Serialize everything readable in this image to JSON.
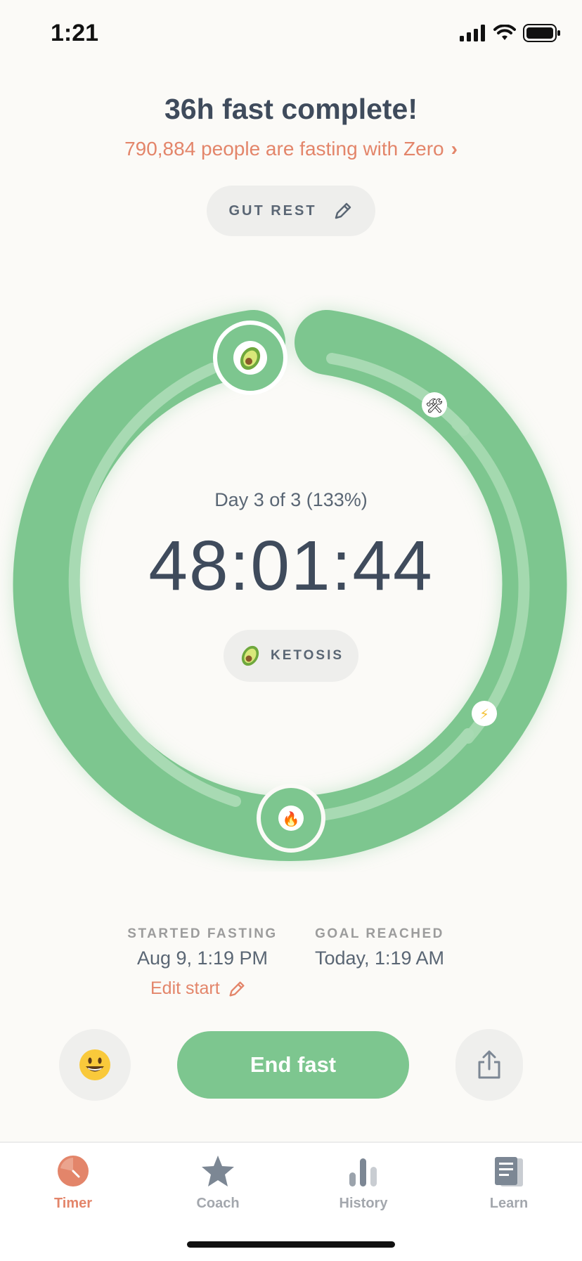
{
  "status_bar": {
    "time": "1:21"
  },
  "header": {
    "title": "36h fast complete!",
    "subtitle": "790,884 people are fasting with Zero",
    "subtitle_chevron": "›",
    "fast_type": "GUT REST"
  },
  "timer": {
    "day_label": "Day 3 of 3 (133%)",
    "elapsed": "48:01:44",
    "stage": "KETOSIS",
    "progress_percent": 133,
    "stage_icons": [
      "avocado-icon",
      "tools-icon",
      "lightning-icon",
      "fire-icon"
    ]
  },
  "details": {
    "started_label": "STARTED FASTING",
    "started_value": "Aug 9, 1:19 PM",
    "goal_label": "GOAL REACHED",
    "goal_value": "Today, 1:19 AM",
    "edit_start": "Edit start"
  },
  "actions": {
    "end_fast": "End fast"
  },
  "tabs": [
    {
      "label": "Timer",
      "active": true
    },
    {
      "label": "Coach",
      "active": false
    },
    {
      "label": "History",
      "active": false
    },
    {
      "label": "Learn",
      "active": false
    }
  ],
  "colors": {
    "accent": "#E3856A",
    "ring_green": "#7DC68F",
    "text_dark": "#3F4B5C",
    "background": "#FBFAF7"
  }
}
